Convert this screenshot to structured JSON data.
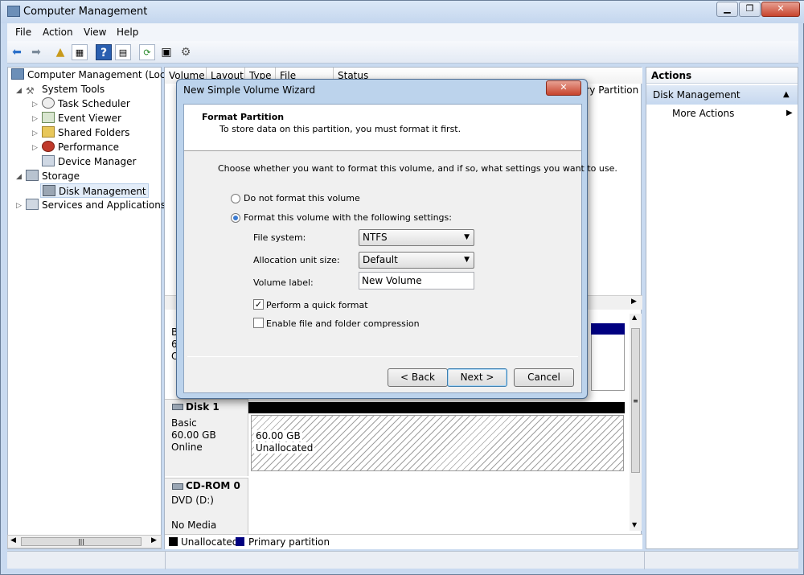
{
  "window": {
    "title": "Computer Management"
  },
  "menu": [
    "File",
    "Action",
    "View",
    "Help"
  ],
  "tree": {
    "root": "Computer Management (Local",
    "system_tools": "System Tools",
    "task_scheduler": "Task Scheduler",
    "event_viewer": "Event Viewer",
    "shared_folders": "Shared Folders",
    "performance": "Performance",
    "device_manager": "Device Manager",
    "storage": "Storage",
    "disk_management": "Disk Management",
    "services": "Services and Applications"
  },
  "volume_list": {
    "columns": [
      "Volume",
      "Layout",
      "Type",
      "File System",
      "Status"
    ],
    "row_status_fragment": "ary Partition"
  },
  "disk0_fragment": {
    "type": "B",
    "size": "60",
    "state": "O"
  },
  "disk1": {
    "name": "Disk 1",
    "type": "Basic",
    "size": "60.00 GB",
    "state": "Online",
    "part_size": "60.00 GB",
    "part_label": "Unallocated"
  },
  "cdrom": {
    "name": "CD-ROM 0",
    "drive": "DVD (D:)",
    "media": "No Media"
  },
  "legend": {
    "unallocated": "Unallocated",
    "primary": "Primary partition"
  },
  "actions": {
    "header": "Actions",
    "section": "Disk Management",
    "more": "More Actions"
  },
  "dialog": {
    "title": "New Simple Volume Wizard",
    "heading": "Format Partition",
    "subheading": "To store data on this partition, you must format it first.",
    "instruction": "Choose whether you want to format this volume, and if so, what settings you want to use.",
    "opt_no_format": "Do not format this volume",
    "opt_format": "Format this volume with the following settings:",
    "fs_label": "File system:",
    "fs_value": "NTFS",
    "alloc_label": "Allocation unit size:",
    "alloc_value": "Default",
    "vol_label": "Volume label:",
    "vol_value": "New Volume",
    "quick_format": "Perform a quick format",
    "compression": "Enable file and folder compression",
    "back": "< Back",
    "next": "Next >",
    "cancel": "Cancel"
  },
  "colors": {
    "primary_partition": "#000080",
    "unallocated": "#000000",
    "accent": "#3a7bd1"
  }
}
